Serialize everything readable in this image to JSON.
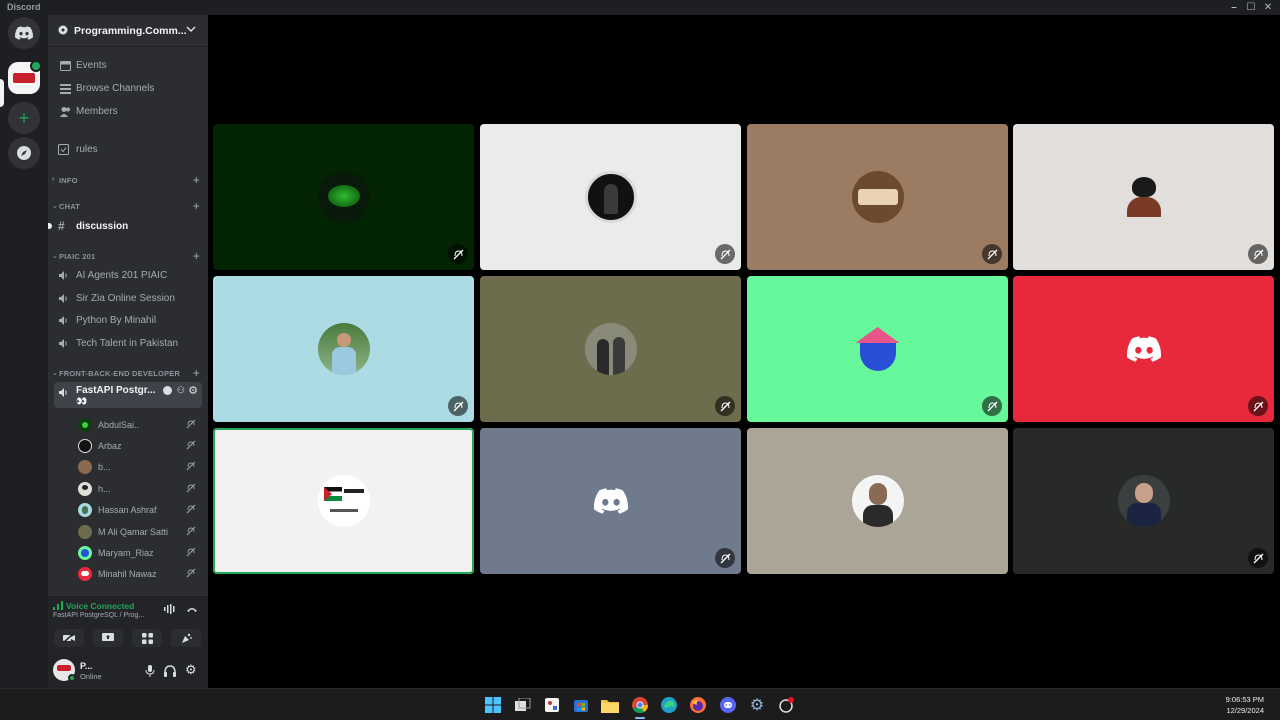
{
  "app": {
    "title": "Discord"
  },
  "server": {
    "name": "Programming.Comm..."
  },
  "nav": [
    {
      "label": "Events",
      "icon": "calendar-icon"
    },
    {
      "label": "Browse Channels",
      "icon": "list-icon"
    },
    {
      "label": "Members",
      "icon": "members-icon"
    }
  ],
  "channels": {
    "rules": "rules",
    "info_category": "INFO",
    "chat_category": "CHAT",
    "discussion": "discussion",
    "piaic_category": "PIAIC 201",
    "piaic_channels": [
      "AI Agents 201 PIAIC",
      "Sir Zia Online Session",
      "Python By Minahil",
      "Tech Talent in Pakistan"
    ],
    "febe_category": "FRONT-BACK-END DEVELOPER",
    "active_voice": "FastAPI Postgr...",
    "active_voice_emoji": "👀"
  },
  "voice_users": [
    "AbdulSai..",
    "Arbaz",
    "b...",
    "h...",
    "Hassan Ashraf",
    "M Ali Qamar Satti",
    "Maryam_Riaz",
    "Minahil Nawaz"
  ],
  "voice_panel": {
    "status": "Voice Connected",
    "channel": "FastAPI PostgreSQL / Prog..."
  },
  "user": {
    "name": "P...",
    "status": "Online"
  },
  "colors": {
    "accent_green": "#23a55a",
    "discord_blurple": "#5865f2",
    "discord_red": "#e8293b"
  },
  "tiles": [
    {
      "bg": "#032403",
      "avatar": "green-logo"
    },
    {
      "bg": "#ebebea",
      "avatar": "hooded-figure"
    },
    {
      "bg": "#9b7b62",
      "avatar": "babar-online-logo"
    },
    {
      "bg": "#e1dedc",
      "avatar": "anime-boy"
    },
    {
      "bg": "#abdbe3",
      "avatar": "man-outdoors"
    },
    {
      "bg": "#6d6c4c",
      "avatar": "two-men"
    },
    {
      "bg": "#68f89c",
      "avatar": "blue-house-character"
    },
    {
      "bg": "#e8293b",
      "avatar": "discord-logo"
    },
    {
      "bg": "#f3f1f1",
      "avatar": "freedom-palestine-logo"
    },
    {
      "bg": "#707a8d",
      "avatar": "discord-logo"
    },
    {
      "bg": "#aaa597",
      "avatar": "bearded-man"
    },
    {
      "bg": "#272a26",
      "avatar": "man-in-suit"
    }
  ],
  "clock": {
    "time": "9:06:53 PM",
    "date": "12/29/2024"
  }
}
